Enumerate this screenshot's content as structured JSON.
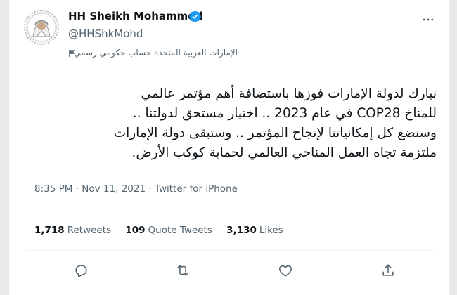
{
  "tweet": {
    "author": {
      "name": "HH Sheikh Mohammed",
      "handle": "@HHShkMohd",
      "label": "الإمارات العربية المتحدة حساب حكومي رسمي"
    },
    "text_lines": [
      "نبارك لدولة الإمارات فوزها باستضافة أهم مؤتمر عالمي",
      "للمناخ COP28 في عام 2023 .. اختيار مستحق لدولتنا ..",
      "وسنضع كل إمكانياتنا لإنجاح المؤتمر .. وستبقى دولة الإمارات",
      "ملتزمة تجاه العمل المناخي العالمي لحماية كوكب الأرض."
    ],
    "time": "8:35 PM",
    "date": "Nov 11, 2021",
    "separator": "·",
    "source": "Twitter for iPhone",
    "stats": {
      "retweets": {
        "value": "1,718",
        "label": "Retweets"
      },
      "quotes": {
        "value": "109",
        "label": "Quote Tweets"
      },
      "likes": {
        "value": "3,130",
        "label": "Likes"
      }
    }
  },
  "colors": {
    "verified": "#1d9bf0",
    "muted": "#536471",
    "text": "#0f1419"
  },
  "icons": [
    "verified-badge-icon",
    "more-options-icon",
    "flag-icon",
    "reply-icon",
    "retweet-icon",
    "like-icon",
    "share-icon"
  ]
}
